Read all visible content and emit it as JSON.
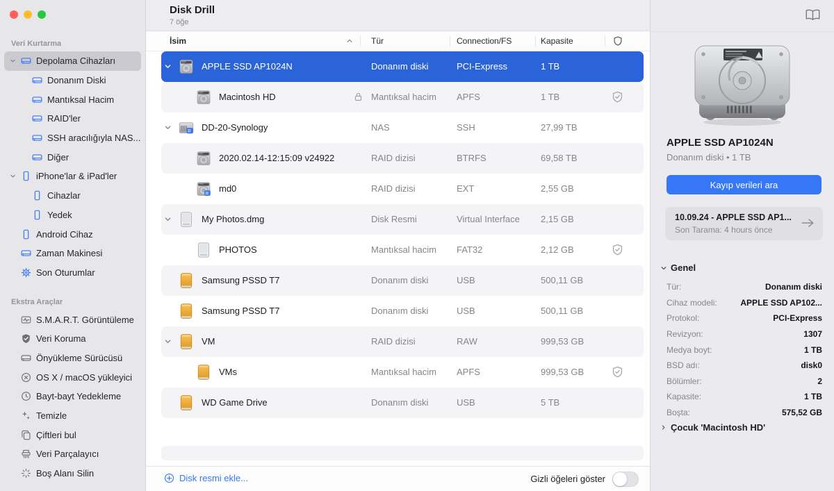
{
  "window": {
    "title": "Disk Drill",
    "items_count": "7 öğe"
  },
  "colors": {
    "accent": "#3478f6",
    "selection": "#2b64d9",
    "traffic_lights": [
      "#ff5f57",
      "#febc2e",
      "#28c840"
    ]
  },
  "sidebar": {
    "items": [
      {
        "header": true,
        "label": "Veri Kurtarma"
      },
      {
        "label": "Depolama Cihazları",
        "icon": "drive",
        "blue": true,
        "chevron": true,
        "selected": true
      },
      {
        "label": "Donanım Diski",
        "icon": "drive",
        "blue": true,
        "indent": true
      },
      {
        "label": "Mantıksal Hacim",
        "icon": "drive",
        "blue": true,
        "indent": true
      },
      {
        "label": "RAID'ler",
        "icon": "drive",
        "blue": true,
        "indent": true
      },
      {
        "label": "SSH aracılığıyla NAS...",
        "icon": "drive",
        "blue": true,
        "indent": true
      },
      {
        "label": "Diğer",
        "icon": "drive",
        "blue": true,
        "indent": true
      },
      {
        "label": "iPhone'lar & iPad'ler",
        "icon": "phone",
        "blue": true,
        "chevron": true
      },
      {
        "label": "Cihazlar",
        "icon": "phone",
        "blue": true,
        "indent": true
      },
      {
        "label": "Yedek",
        "icon": "phone",
        "blue": true,
        "indent": true
      },
      {
        "label": "Android Cihaz",
        "icon": "phone",
        "blue": true
      },
      {
        "label": "Zaman Makinesi",
        "icon": "drive",
        "blue": true
      },
      {
        "label": "Son Oturumlar",
        "icon": "gear",
        "blue": true
      },
      {
        "header": true,
        "label": "Ekstra Araçlar"
      },
      {
        "label": "S.M.A.R.T. Görüntüleme",
        "icon": "smart",
        "gray": true
      },
      {
        "label": "Veri Koruma",
        "icon": "shield-fill",
        "gray": true
      },
      {
        "label": "Önyükleme Sürücüsü",
        "icon": "drive",
        "gray": true
      },
      {
        "label": "OS X / macOS yükleyici",
        "icon": "circle-x",
        "gray": true
      },
      {
        "label": "Bayt-bayt Yedekleme",
        "icon": "history",
        "gray": true
      },
      {
        "label": "Temizle",
        "icon": "sparkle",
        "gray": true
      },
      {
        "label": "Çiftleri bul",
        "icon": "duplicates",
        "gray": true
      },
      {
        "label": "Veri Parçalayıcı",
        "icon": "shredder",
        "gray": true
      },
      {
        "label": "Boş Alanı Silin",
        "icon": "erase",
        "gray": true
      }
    ]
  },
  "table": {
    "columns": {
      "name": "İsim",
      "type": "Tür",
      "connection": "Connection/FS",
      "capacity": "Kapasite"
    },
    "rows": [
      {
        "name": "APPLE SSD AP1024N",
        "type": "Donanım diski",
        "connection": "PCI-Express",
        "capacity": "1 TB",
        "icon": "hdd",
        "chevron": true,
        "selected": true
      },
      {
        "name": "Macintosh HD",
        "type": "Mantıksal hacim",
        "connection": "APFS",
        "capacity": "1 TB",
        "icon": "hdd",
        "indent": true,
        "lock": true,
        "protected": true
      },
      {
        "name": "DD-20-Synology",
        "type": "NAS",
        "connection": "SSH",
        "capacity": "27,99 TB",
        "icon": "nas",
        "chevron": true
      },
      {
        "name": "2020.02.14-12:15:09 v24922",
        "type": "RAID dizisi",
        "connection": "BTRFS",
        "capacity": "69,58 TB",
        "icon": "hdd",
        "indent": true
      },
      {
        "name": "md0",
        "type": "RAID dizisi",
        "connection": "EXT",
        "capacity": "2,55 GB",
        "icon": "hdd-b",
        "indent": true
      },
      {
        "name": "My Photos.dmg",
        "type": "Disk Resmi",
        "connection": "Virtual Interface",
        "capacity": "2,15 GB",
        "icon": "dmg",
        "chevron": true
      },
      {
        "name": "PHOTOS",
        "type": "Mantıksal hacim",
        "connection": "FAT32",
        "capacity": "2,12 GB",
        "icon": "dmg",
        "indent": true,
        "protected": true
      },
      {
        "name": "Samsung PSSD T7",
        "type": "Donanım diski",
        "connection": "USB",
        "capacity": "500,11 GB",
        "icon": "ext"
      },
      {
        "name": "Samsung PSSD T7",
        "type": "Donanım diski",
        "connection": "USB",
        "capacity": "500,11 GB",
        "icon": "ext"
      },
      {
        "name": "VM",
        "type": "RAID dizisi",
        "connection": "RAW",
        "capacity": "999,53 GB",
        "icon": "ext",
        "chevron": true
      },
      {
        "name": "VMs",
        "type": "Mantıksal hacim",
        "connection": "APFS",
        "capacity": "999,53 GB",
        "icon": "ext",
        "indent": true,
        "protected": true
      },
      {
        "name": "WD Game Drive",
        "type": "Donanım diski",
        "connection": "USB",
        "capacity": "5 TB",
        "icon": "ext"
      }
    ]
  },
  "footer": {
    "add_disk_image": "Disk resmi ekle...",
    "show_hidden_label": "Gizli öğeleri göster",
    "toggle_on": false
  },
  "inspector": {
    "title": "APPLE SSD AP1024N",
    "subtitle": "Donanım diski • 1 TB",
    "scan_button": "Kayıp verileri ara",
    "scan_card": {
      "title": "10.09.24 - APPLE SSD AP1...",
      "subtitle": "Son Tarama: 4 hours önce"
    },
    "section_title": "Genel",
    "details": [
      {
        "label": "Tür:",
        "value": "Donanım diski"
      },
      {
        "label": "Cihaz modeli:",
        "value": "APPLE SSD AP102..."
      },
      {
        "label": "Protokol:",
        "value": "PCI-Express"
      },
      {
        "label": "Revizyon:",
        "value": "1307"
      },
      {
        "label": "Medya boyt:",
        "value": "1 TB"
      },
      {
        "label": "BSD adı:",
        "value": "disk0"
      },
      {
        "label": "Bölümler:",
        "value": "2"
      },
      {
        "label": "Kapasite:",
        "value": "1 TB"
      },
      {
        "label": "Boşta:",
        "value": "575,52 GB"
      }
    ],
    "child_link": "Çocuk 'Macintosh HD'"
  }
}
